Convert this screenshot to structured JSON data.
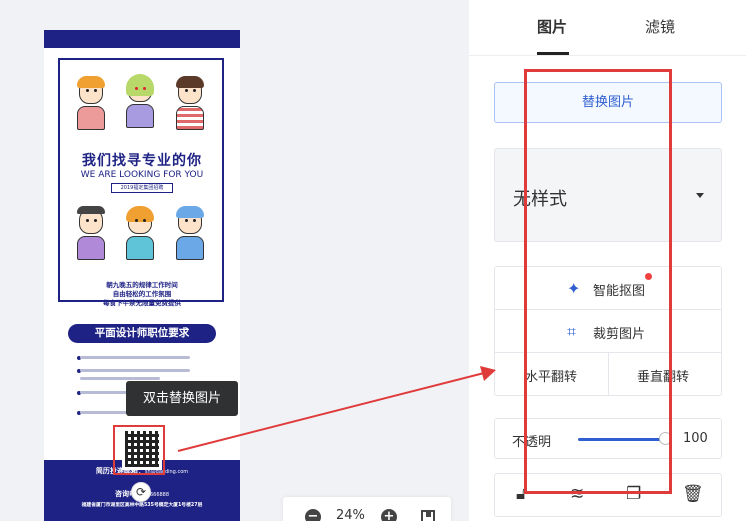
{
  "poster": {
    "title": "我们找寻专业的你",
    "subtitle": "WE ARE LOOKING FOR YOU",
    "tag": "2019福定集团招聘",
    "benefits": [
      "朝九晚五的规律工作时间",
      "自由轻松的工作氛围",
      "每食下午茶无限量免费提供"
    ],
    "job_title": "平面设计师职位要求",
    "contact_email_label": "简历投递邮箱：",
    "contact_email": "sh@gaoding.com",
    "contact_phone_label": "咨询电话：",
    "contact_phone": "666888",
    "address": "福建省厦门市湖里区高林中路535号稿定大厦1号楼27层"
  },
  "tooltip": "双击替换图片",
  "zoom": {
    "value": "24%",
    "minus": "−",
    "plus": "+"
  },
  "panel": {
    "tabs": [
      {
        "label": "图片",
        "active": true
      },
      {
        "label": "滤镜",
        "active": false
      }
    ],
    "replace_button": "替换图片",
    "style_select": "无样式",
    "tools": {
      "smart_cutout": "智能抠图",
      "crop": "裁剪图片",
      "flip_h": "水平翻转",
      "flip_v": "垂直翻转"
    },
    "opacity": {
      "label": "不透明",
      "value": "100",
      "level": 1.0
    },
    "icons": [
      "lock-icon",
      "layer-icon",
      "copy-icon",
      "delete-icon"
    ]
  },
  "colors": {
    "brand_navy": "#1e2284",
    "accent_blue": "#2f5fd0",
    "annotation_red": "#e03b3b"
  }
}
